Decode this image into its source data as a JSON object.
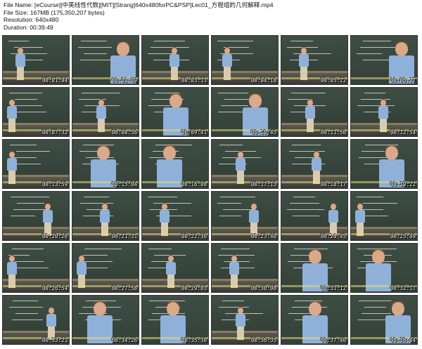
{
  "header": {
    "file_name": "File Name: [eCourse][中英线性代数][MIT][Strang]640x480forPC&PSP]Lec01_方程组的几何解释.mp4",
    "file_size": "File Size: 167MB (175,350,207 bytes)",
    "resolution": "Resolution: 640x480",
    "duration": "Duration: 00:39:49"
  },
  "thumbnails": [
    {
      "time": "00:01:04"
    },
    {
      "time": "00:02:09"
    },
    {
      "time": "00:03:13"
    },
    {
      "time": "00:04:18"
    },
    {
      "time": "00:05:22"
    },
    {
      "time": "00:06:27"
    },
    {
      "time": "00:07:32"
    },
    {
      "time": "00:08:36"
    },
    {
      "time": "00:09:41"
    },
    {
      "time": "00:10:45"
    },
    {
      "time": "00:11:50"
    },
    {
      "time": "00:12:54"
    },
    {
      "time": "00:13:59"
    },
    {
      "time": "00:15:04"
    },
    {
      "time": "00:16:08"
    },
    {
      "time": "00:17:13"
    },
    {
      "time": "00:18:17"
    },
    {
      "time": "00:19:22"
    },
    {
      "time": "00:20:26"
    },
    {
      "time": "00:21:31"
    },
    {
      "time": "00:22:36"
    },
    {
      "time": "00:23:40"
    },
    {
      "time": "00:24:45"
    },
    {
      "time": "00:25:49"
    },
    {
      "time": "00:26:54"
    },
    {
      "time": "00:27:58"
    },
    {
      "time": "00:29:03"
    },
    {
      "time": "00:30:08"
    },
    {
      "time": "00:31:12"
    },
    {
      "time": "00:32:17"
    },
    {
      "time": "00:33:21"
    },
    {
      "time": "00:34:26"
    },
    {
      "time": "00:35:30"
    },
    {
      "time": "00:36:35"
    },
    {
      "time": "00:37:40"
    },
    {
      "time": "00:38:44"
    }
  ]
}
